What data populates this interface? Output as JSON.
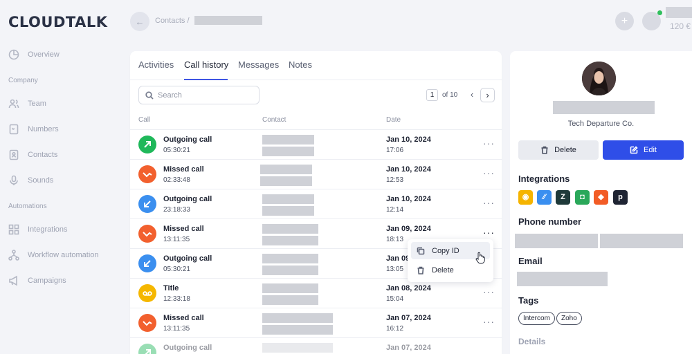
{
  "app": {
    "logo": "CLOUDTALK"
  },
  "sidebar": {
    "items": [
      {
        "label": "Overview",
        "icon": "pie-chart-icon"
      },
      {
        "label": "Team",
        "icon": "users-icon"
      },
      {
        "label": "Numbers",
        "icon": "phone-book-icon"
      },
      {
        "label": "Contacts",
        "icon": "contact-card-icon"
      },
      {
        "label": "Sounds",
        "icon": "microphone-icon"
      },
      {
        "label": "Integrations",
        "icon": "grid-icon"
      },
      {
        "label": "Workflow automation",
        "icon": "flow-icon"
      },
      {
        "label": "Campaigns",
        "icon": "megaphone-icon"
      }
    ],
    "sections": {
      "company": "Company",
      "automations": "Automations"
    }
  },
  "topbar": {
    "breadcrumb": "Contacts /",
    "plus": "+",
    "balance": "120 €"
  },
  "tabs": [
    "Activities",
    "Call history",
    "Messages",
    "Notes"
  ],
  "active_tab": "Call history",
  "search": {
    "placeholder": "Search",
    "value": ""
  },
  "pagination": {
    "current": "1",
    "of": "of 10",
    "prev": "‹",
    "next": "›"
  },
  "columns": {
    "call": "Call",
    "contact": "Contact",
    "date": "Date"
  },
  "calls": [
    {
      "type": "Outgoing call",
      "duration": "05:30:21",
      "date": "Jan 10, 2024",
      "time": "17:06",
      "kind": "outgoing-green"
    },
    {
      "type": "Missed call",
      "duration": "02:33:48",
      "date": "Jan 10, 2024",
      "time": "12:53",
      "kind": "missed"
    },
    {
      "type": "Outgoing call",
      "duration": "23:18:33",
      "date": "Jan 10, 2024",
      "time": "12:14",
      "kind": "outgoing-blue"
    },
    {
      "type": "Missed call",
      "duration": "13:11:35",
      "date": "Jan 09, 2024",
      "time": "18:13",
      "kind": "missed"
    },
    {
      "type": "Outgoing call",
      "duration": "05:30:21",
      "date": "Jan 09",
      "time": "13:05",
      "kind": "outgoing-blue"
    },
    {
      "type": "Title",
      "duration": "12:33:18",
      "date": "Jan 08, 2024",
      "time": "15:04",
      "kind": "voicemail"
    },
    {
      "type": "Missed call",
      "duration": "13:11:35",
      "date": "Jan 07, 2024",
      "time": "16:12",
      "kind": "missed"
    },
    {
      "type": "Outgoing call",
      "duration": "",
      "date": "Jan 07, 2024",
      "time": "",
      "kind": "outgoing-green"
    }
  ],
  "more_label": "···",
  "context_menu": {
    "copy": "Copy ID",
    "delete": "Delete"
  },
  "contact": {
    "company": "Tech Departure Co.",
    "delete_label": "Delete",
    "edit_label": "Edit",
    "integrations_title": "Integrations",
    "integrations": [
      {
        "name": "integration-1",
        "glyph": "◉",
        "color": "#f5b400"
      },
      {
        "name": "integration-2",
        "glyph": "⁄⁄",
        "color": "#3a8ff0"
      },
      {
        "name": "integration-3",
        "glyph": "Z",
        "color": "#1f3a3a"
      },
      {
        "name": "integration-4",
        "glyph": "◘",
        "color": "#2aa85a"
      },
      {
        "name": "integration-5",
        "glyph": "◆",
        "color": "#f25c26"
      },
      {
        "name": "integration-6",
        "glyph": "p",
        "color": "#1f2433"
      }
    ],
    "phone_title": "Phone number",
    "email_title": "Email",
    "tags_title": "Tags",
    "tags": [
      "Intercom",
      "Zoho"
    ],
    "details_title": "Details"
  },
  "colors": {
    "accent": "#2f4ee8",
    "outgoing_green": "#1fb85a",
    "outgoing_blue": "#3b8fef",
    "missed": "#f2602e",
    "voicemail": "#f5b700"
  }
}
